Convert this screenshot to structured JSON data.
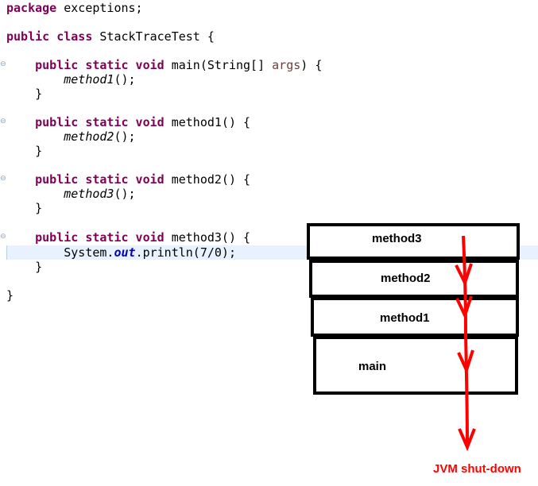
{
  "code": {
    "package_kw": "package",
    "package_rest": " exceptions;",
    "class_kw1": "public",
    "class_kw2": "class",
    "class_rest": " StackTraceTest {",
    "main_kw": "    public static void",
    "main_sig1": " main(String[] ",
    "main_param": "args",
    "main_sig2": ") {",
    "main_call": "method1",
    "call_tail": "();",
    "close_brace": "    }",
    "m1_kw": "    public static void",
    "m1_sig": " method1() {",
    "m1_call": "method2",
    "m2_kw": "    public static void",
    "m2_sig": " method2() {",
    "m2_call": "method3",
    "m3_kw": "    public static void",
    "m3_sig": " method3() {",
    "m3_body1": "        System.",
    "m3_field": "out",
    "m3_body2": ".println(7/0);",
    "class_close": "}",
    "indent_call": "        "
  },
  "stack": {
    "frames": [
      "method3",
      "method2",
      "method1",
      "main"
    ]
  },
  "annotation": {
    "jvm_label": "JVM shut-down",
    "arrow_color": "#ff0000"
  },
  "icons": {
    "fold": "fold-marker-icon"
  }
}
